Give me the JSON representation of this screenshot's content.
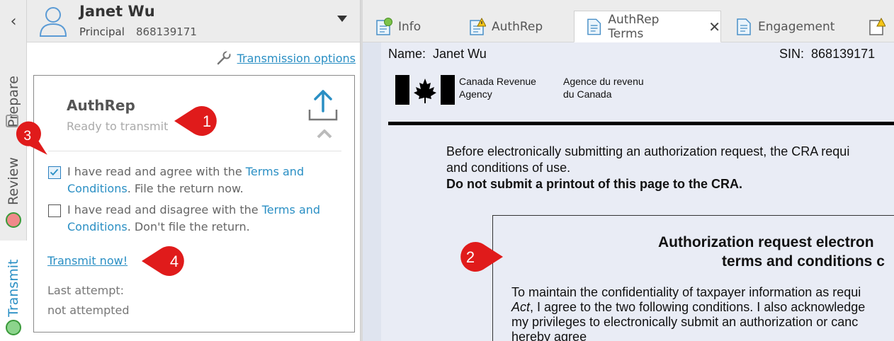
{
  "client": {
    "name": "Janet Wu",
    "role": "Principal",
    "sin": "868139171"
  },
  "rail": {
    "back_icon": "chevron-left-icon",
    "tabs": [
      {
        "label": "Prepare",
        "icon": "notepad-icon"
      },
      {
        "label": "Review",
        "icon": "review-badge-icon"
      },
      {
        "label": "Transmit",
        "icon": "transmit-badge-icon"
      }
    ]
  },
  "left_panel": {
    "transmission_options": "Transmission options",
    "card": {
      "title": "AuthRep",
      "status": "Ready to transmit",
      "agree": {
        "prefix": "I have read and agree with the ",
        "link": "Terms and Conditions",
        "suffix": ". File the return now.",
        "checked": true
      },
      "disagree": {
        "prefix": "I have read and disagree with the ",
        "link": "Terms and Conditions",
        "suffix": ". Don't file the return.",
        "checked": false
      },
      "transmit_now": "Transmit now!",
      "last_attempt_label": "Last attempt:",
      "last_attempt_value": "not attempted"
    }
  },
  "doc_tabs": [
    {
      "label": "Info",
      "icon": "doc-green-icon"
    },
    {
      "label": "AuthRep",
      "icon": "doc-warning-icon"
    },
    {
      "label": "AuthRep Terms",
      "icon": "doc-icon",
      "active": true
    },
    {
      "label": "Engagement",
      "icon": "doc-icon"
    }
  ],
  "document": {
    "name_label": "Name:",
    "name_value": "Janet Wu",
    "sin_label": "SIN:",
    "sin_value": "868139171",
    "agency_en_1": "Canada Revenue",
    "agency_en_2": "Agency",
    "agency_fr_1": "Agence du revenu",
    "agency_fr_2": "du Canada",
    "intro_1": "Before electronically submitting an authorization request, the CRA requi",
    "intro_2": "and conditions of use.",
    "intro_3": "Do not submit a printout of this page to the CRA.",
    "box_title_1": "Authorization request electron",
    "box_title_2": "terms and conditions c",
    "box_para_1": "To maintain the confidentiality of taxpayer information as requi",
    "box_para_2_em": "Act",
    "box_para_2_rest": ", I agree to the two following conditions. I also acknowledge",
    "box_para_3": "my privileges to electronically submit an authorization or canc",
    "box_para_4": "hereby agree"
  },
  "callouts": [
    "1",
    "2",
    "3",
    "4"
  ],
  "colors": {
    "link": "#2a8fc4",
    "callout": "#e01b1b",
    "rail_bg": "#ececec",
    "doc_bg": "#e9ecf5"
  }
}
